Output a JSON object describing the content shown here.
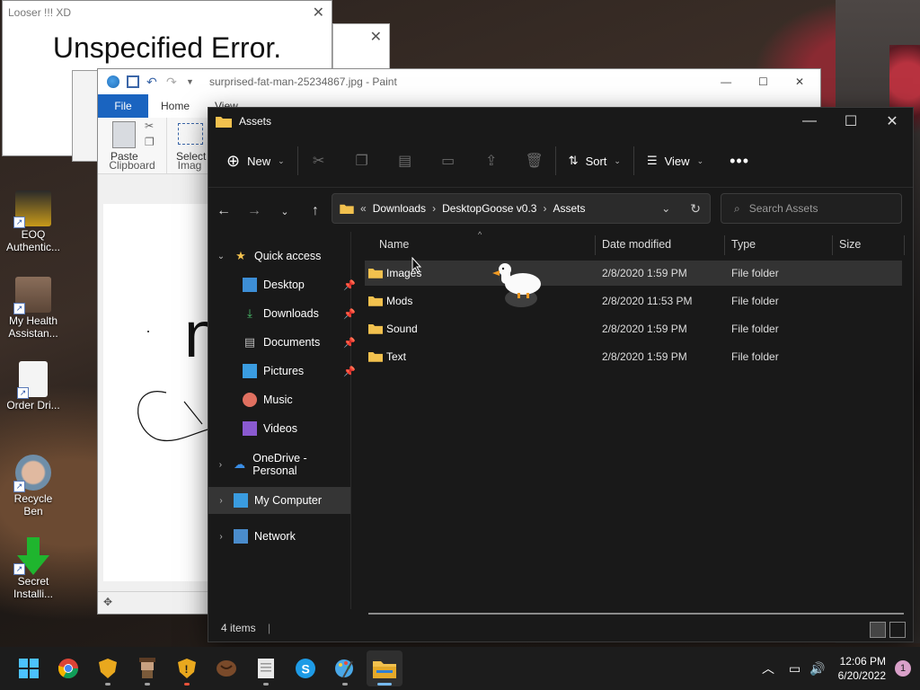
{
  "error_window": {
    "title": "Looser !!! XD",
    "message": "Unspecified Error."
  },
  "paint": {
    "title": "surprised-fat-man-25234867.jpg - Paint",
    "tabs": [
      "File",
      "Home",
      "View"
    ],
    "paste_label": "Paste",
    "select_label": "Select",
    "clipboard_label": "Clipboard",
    "image_label": "Imag"
  },
  "desktop_icons": [
    {
      "label": "EOQ Authentic...",
      "icon": "eoq-icon"
    },
    {
      "label": "My Health Assistan...",
      "icon": "pixel-character-icon"
    },
    {
      "label": "Order Dri...",
      "icon": "file-icon"
    },
    {
      "label": "Recycle Ben",
      "icon": "face-icon"
    },
    {
      "label": "Secret Installi...",
      "icon": "download-arrow-icon"
    }
  ],
  "explorer": {
    "title": "Assets",
    "commands": {
      "new": "New",
      "sort": "Sort",
      "view": "View"
    },
    "breadcrumb": [
      "Downloads",
      "DesktopGoose v0.3",
      "Assets"
    ],
    "search_placeholder": "Search Assets",
    "nav": {
      "quick_access": "Quick access",
      "desktop": "Desktop",
      "downloads": "Downloads",
      "documents": "Documents",
      "pictures": "Pictures",
      "music": "Music",
      "videos": "Videos",
      "onedrive": "OneDrive - Personal",
      "my_computer": "My Computer",
      "network": "Network"
    },
    "columns": {
      "name": "Name",
      "date": "Date modified",
      "type": "Type",
      "size": "Size"
    },
    "files": [
      {
        "name": "Images",
        "date": "2/8/2020 1:59 PM",
        "type": "File folder"
      },
      {
        "name": "Mods",
        "date": "2/8/2020 11:53 PM",
        "type": "File folder"
      },
      {
        "name": "Sound",
        "date": "2/8/2020 1:59 PM",
        "type": "File folder"
      },
      {
        "name": "Text",
        "date": "2/8/2020 1:59 PM",
        "type": "File folder"
      }
    ],
    "status": "4 items"
  },
  "taskbar": {
    "time": "12:06 PM",
    "date": "6/20/2022",
    "notification_count": "1",
    "apps": [
      "start-icon",
      "chrome-icon",
      "shield-icon",
      "character-icon",
      "warning-shield-icon",
      "coffee-icon",
      "notepad-icon",
      "skype-icon",
      "paint-icon",
      "file-explorer-icon"
    ]
  },
  "colors": {
    "explorer_bg": "#191919",
    "accent": "#76b9ed",
    "folder": "#f2c14e",
    "paint_file_tab": "#1a64c0"
  }
}
